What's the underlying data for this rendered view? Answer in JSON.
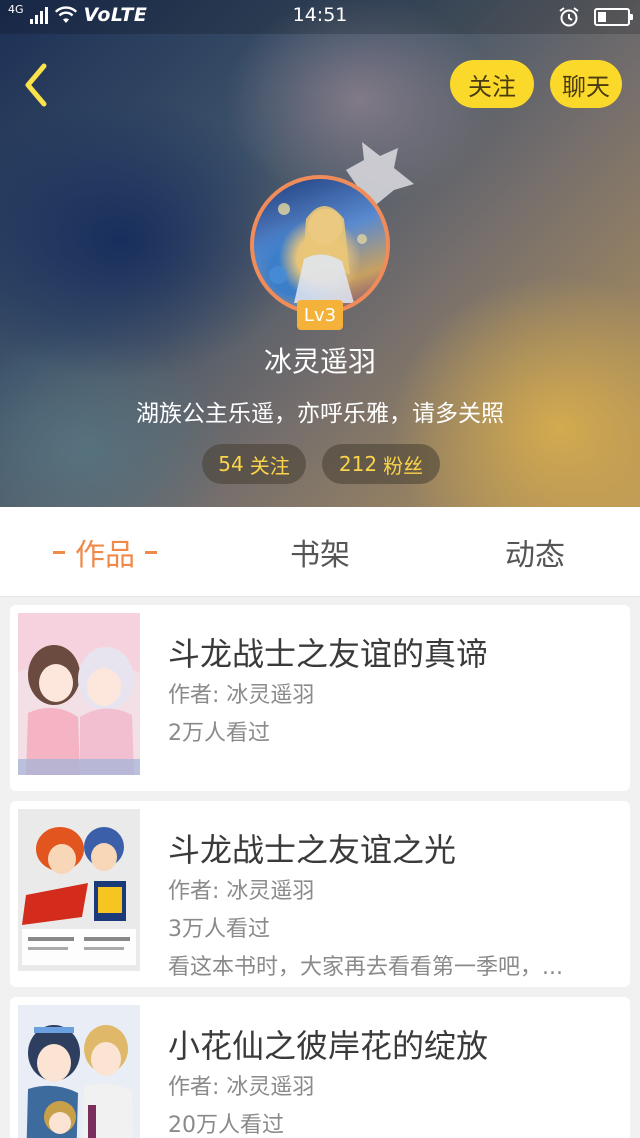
{
  "status_bar": {
    "network": "4G",
    "volte": "VoLTE",
    "time": "14:51",
    "battery_level": 0.3
  },
  "header": {
    "follow_label": "关注",
    "chat_label": "聊天"
  },
  "profile": {
    "level": "Lv3",
    "username": "冰灵遥羽",
    "bio": "湖族公主乐遥，亦呼乐雅，请多关照",
    "following_count": "54",
    "following_label": "关注",
    "fans_count": "212",
    "fans_label": "粉丝"
  },
  "tabs": [
    {
      "label": "作品",
      "active": true
    },
    {
      "label": "书架",
      "active": false
    },
    {
      "label": "动态",
      "active": false
    }
  ],
  "works": [
    {
      "title": "斗龙战士之友谊的真谛",
      "author": "作者: 冰灵遥羽",
      "views": "2万人看过",
      "desc": ""
    },
    {
      "title": "斗龙战士之友谊之光",
      "author": "作者: 冰灵遥羽",
      "views": "3万人看过",
      "desc": "看这本书时，大家再去看看第一季吧，..."
    },
    {
      "title": "小花仙之彼岸花的绽放",
      "author": "作者: 冰灵遥羽",
      "views": "20万人看过",
      "desc": ""
    }
  ],
  "colors": {
    "accent_yellow": "#fbd92a",
    "tab_active": "#f08a4b",
    "stat_text": "#fbd44a"
  }
}
